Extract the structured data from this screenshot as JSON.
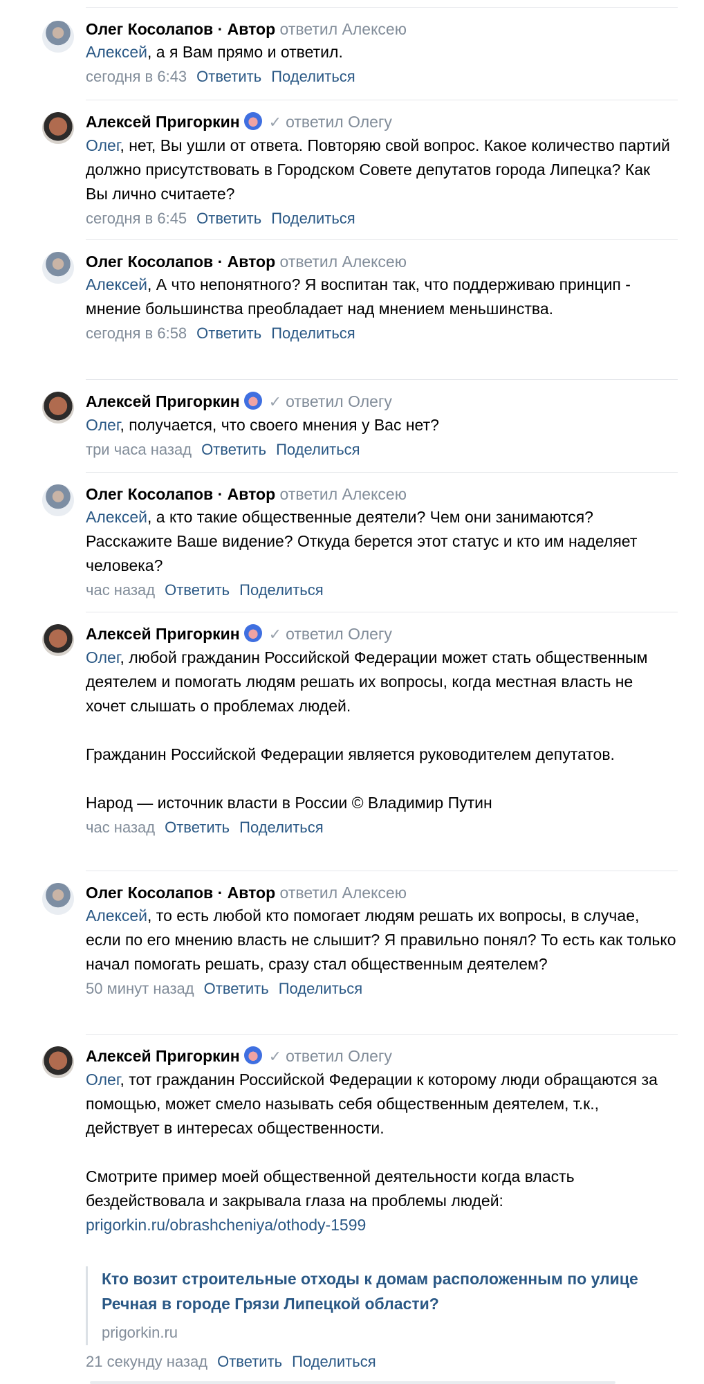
{
  "comments": [
    {
      "author": "Олег Косолапов",
      "author_tag": " · Автор",
      "reply_to": "ответил Алексею",
      "mention": "Алексей",
      "text": ", а я Вам прямо и ответил.",
      "time": "сегодня в 6:43",
      "reply_label": "Ответить",
      "share_label": "Поделиться"
    },
    {
      "author": "Алексей Пригоркин",
      "verified_icon": "check-icon",
      "reply_to": "ответил Олегу",
      "mention": "Олег",
      "text": ", нет, Вы ушли от ответа. Повторяю свой вопрос. Какое количество партий должно присутствовать в Городском Совете депутатов города Липецка? Как Вы лично считаете?",
      "time": "сегодня в 6:45",
      "reply_label": "Ответить",
      "share_label": "Поделиться"
    },
    {
      "author": "Олег Косолапов",
      "author_tag": " · Автор",
      "reply_to": "ответил Алексею",
      "mention": "Алексей",
      "text": ", А что непонятного? Я воспитан так, что поддерживаю принцип - мнение большинства преобладает над мнением меньшинства.",
      "time": "сегодня в 6:58",
      "reply_label": "Ответить",
      "share_label": "Поделиться"
    },
    {
      "author": "Алексей Пригоркин",
      "reply_to": "ответил Олегу",
      "mention": "Олег",
      "text": ", получается, что своего мнения у Вас нет?",
      "time": "три часа назад",
      "reply_label": "Ответить",
      "share_label": "Поделиться"
    },
    {
      "author": "Олег Косолапов",
      "author_tag": " · Автор",
      "reply_to": "ответил Алексею",
      "mention": "Алексей",
      "text": ", а кто такие общественные деятели? Чем они занимаются? Расскажите Ваше видение? Откуда берется этот статус и кто им наделяет человека?",
      "time": "час назад",
      "reply_label": "Ответить",
      "share_label": "Поделиться"
    },
    {
      "author": "Алексей Пригоркин",
      "reply_to": "ответил Олегу",
      "mention": "Олег",
      "text": ", любой гражданин Российской Федерации может стать общественным деятелем и помогать людям решать их вопросы, когда местная власть не хочет слышать о проблемах людей.\n\nГражданин Российской Федерации является руководителем депутатов.\n\nНарод — источник власти в России © Владимир Путин",
      "time": "час назад",
      "reply_label": "Ответить",
      "share_label": "Поделиться"
    },
    {
      "author": "Олег Косолапов",
      "author_tag": " · Автор",
      "reply_to": "ответил Алексею",
      "mention": "Алексей",
      "text": ", то есть любой кто помогает людям решать их вопросы, в случае, если по его мнению власть не слышит? Я правильно понял? То есть как только начал помогать решать, сразу стал общественным деятелем?",
      "time": "50 минут назад",
      "reply_label": "Ответить",
      "share_label": "Поделиться"
    },
    {
      "author": "Алексей Пригоркин",
      "reply_to": "ответил Олегу",
      "mention": "Олег",
      "text": ", тот гражданин Российской Федерации к которому люди обращаются за помощью, может смело называть себя общественным деятелем, т.к., действует в интересах общественности.\n\nСмотрите пример моей общественной деятельности когда власть бездействовала и закрывала глаза на проблемы людей:",
      "link": "prigorkin.ru/obrashcheniya/othody-1599",
      "snippet_title": "Кто возит строительные отходы к домам расположенным по улице Речная в городе Грязи Липецкой области?",
      "snippet_domain": "prigorkin.ru",
      "time": "21 секунду назад",
      "reply_label": "Ответить",
      "share_label": "Поделиться"
    }
  ]
}
